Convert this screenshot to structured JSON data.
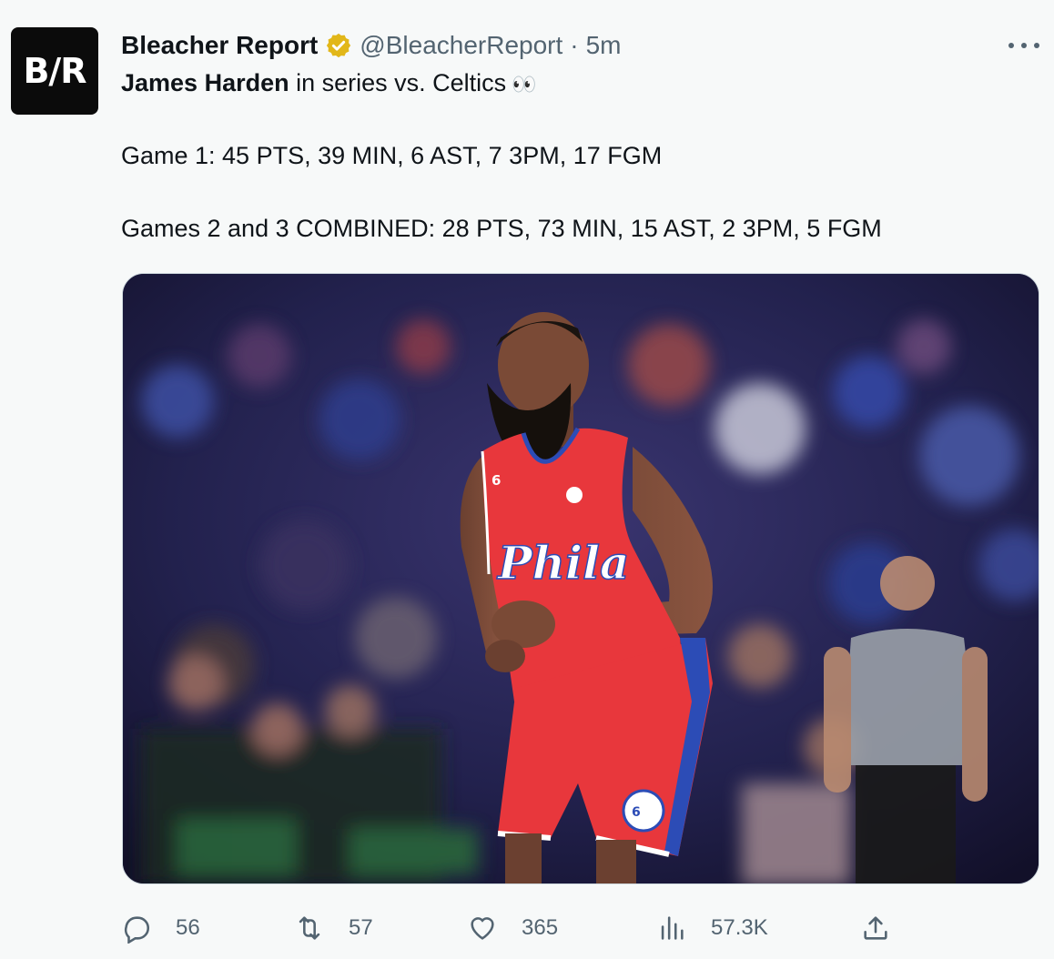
{
  "tweet": {
    "author_name": "Bleacher Report",
    "author_handle": "@BleacherReport",
    "separator": "·",
    "time": "5m",
    "avatar_text": "B/R",
    "text": {
      "line1_bold": "James Harden",
      "line1_rest": " in series vs. Celtics",
      "line1_emoji": "👀",
      "line2": "Game 1: 45 PTS, 39 MIN, 6 AST, 7 3PM, 17 FGM",
      "line3": "Games 2 and 3 COMBINED: 28 PTS, 73 MIN, 15 AST, 2 3PM, 5 FGM"
    },
    "media": {
      "jersey_text": "Phila",
      "jersey_number": "6",
      "shorts_logo": "76ers"
    }
  },
  "actions": {
    "replies": "56",
    "retweets": "57",
    "likes": "365",
    "views": "57.3K"
  },
  "icons": {
    "reply": "reply-icon",
    "retweet": "retweet-icon",
    "like": "heart-icon",
    "views": "views-icon",
    "share": "share-icon",
    "verified": "verified-badge-icon",
    "more": "more-icon"
  },
  "colors": {
    "verified_gold": "#e2b719",
    "secondary_text": "#536471",
    "jersey_red": "#e8373c",
    "jersey_blue": "#2c4cb6"
  }
}
